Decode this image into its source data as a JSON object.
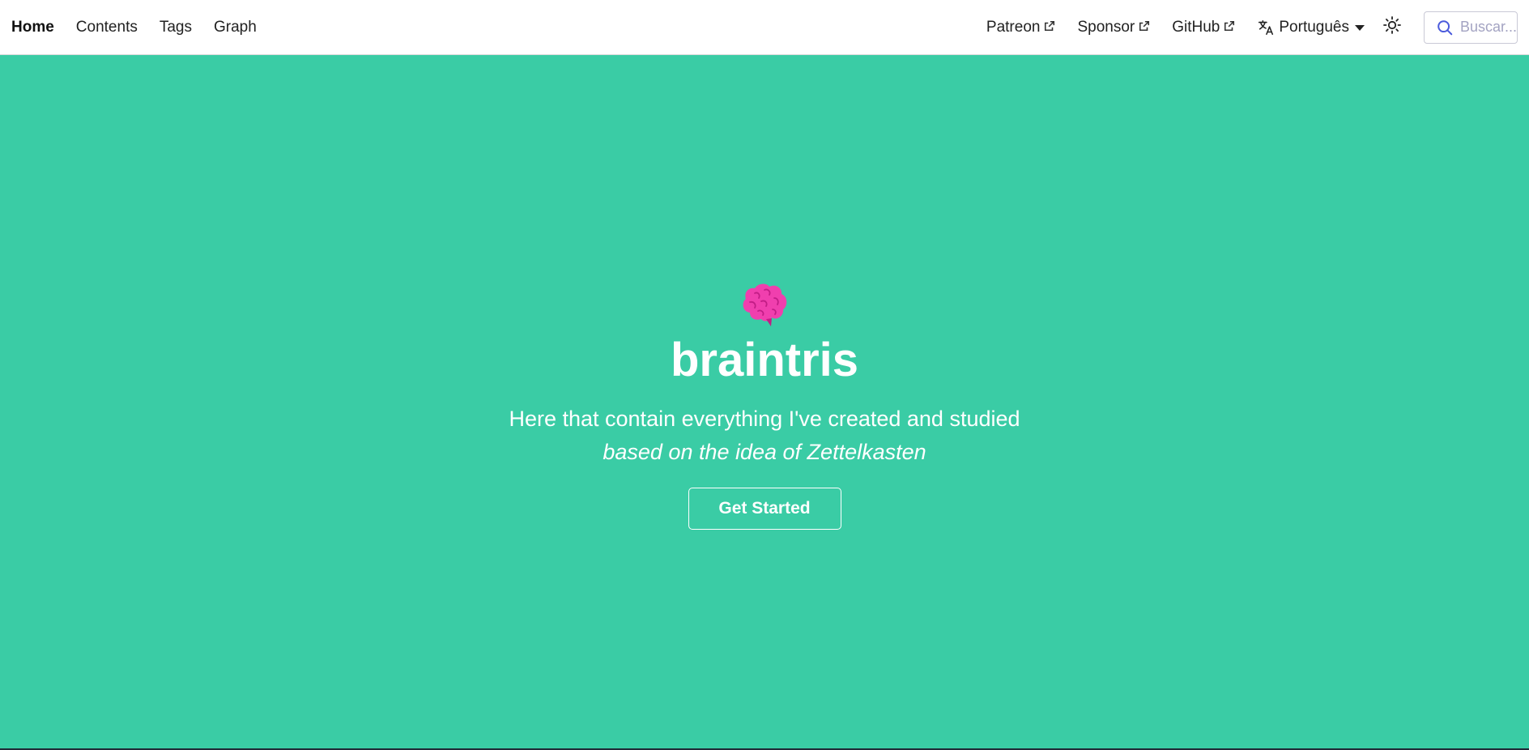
{
  "nav": {
    "left": [
      {
        "label": "Home",
        "active": true
      },
      {
        "label": "Contents"
      },
      {
        "label": "Tags"
      },
      {
        "label": "Graph"
      }
    ],
    "external_links": [
      {
        "label": "Patreon"
      },
      {
        "label": "Sponsor"
      },
      {
        "label": "GitHub"
      }
    ],
    "language": {
      "selected": "Português"
    },
    "search": {
      "placeholder": "Buscar..."
    }
  },
  "hero": {
    "icon": "brain-icon",
    "title": "braintris",
    "subtitle": "Here that contain everything I've created and studied",
    "tagline": "based on the idea of Zettelkasten",
    "cta_label": "Get Started"
  },
  "colors": {
    "hero_background": "#3acca5",
    "brain": "#f03fae",
    "search_icon": "#4b5bdc"
  }
}
